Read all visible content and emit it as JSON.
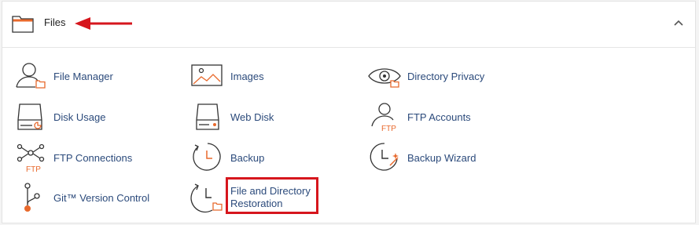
{
  "section": {
    "title": "Files",
    "folder_icon": "folder-icon",
    "collapse_icon": "chevron-up-icon",
    "annotation_color": "#d6161d",
    "accent_color": "#e8692c"
  },
  "items": [
    {
      "label": "File Manager",
      "icon": "file-manager-icon"
    },
    {
      "label": "Images",
      "icon": "images-icon"
    },
    {
      "label": "Directory Privacy",
      "icon": "eye-folder-icon"
    },
    {
      "label": "Disk Usage",
      "icon": "disk-usage-icon"
    },
    {
      "label": "Web Disk",
      "icon": "web-disk-icon"
    },
    {
      "label": "FTP Accounts",
      "icon": "ftp-user-icon"
    },
    {
      "label": "FTP Connections",
      "icon": "network-ftp-icon"
    },
    {
      "label": "Backup",
      "icon": "backup-clock-icon"
    },
    {
      "label": "Backup Wizard",
      "icon": "backup-wand-icon"
    },
    {
      "label": "Git™ Version Control",
      "icon": "git-branch-icon"
    },
    {
      "label": "File and Directory Restoration",
      "icon": "restore-folder-icon"
    }
  ]
}
